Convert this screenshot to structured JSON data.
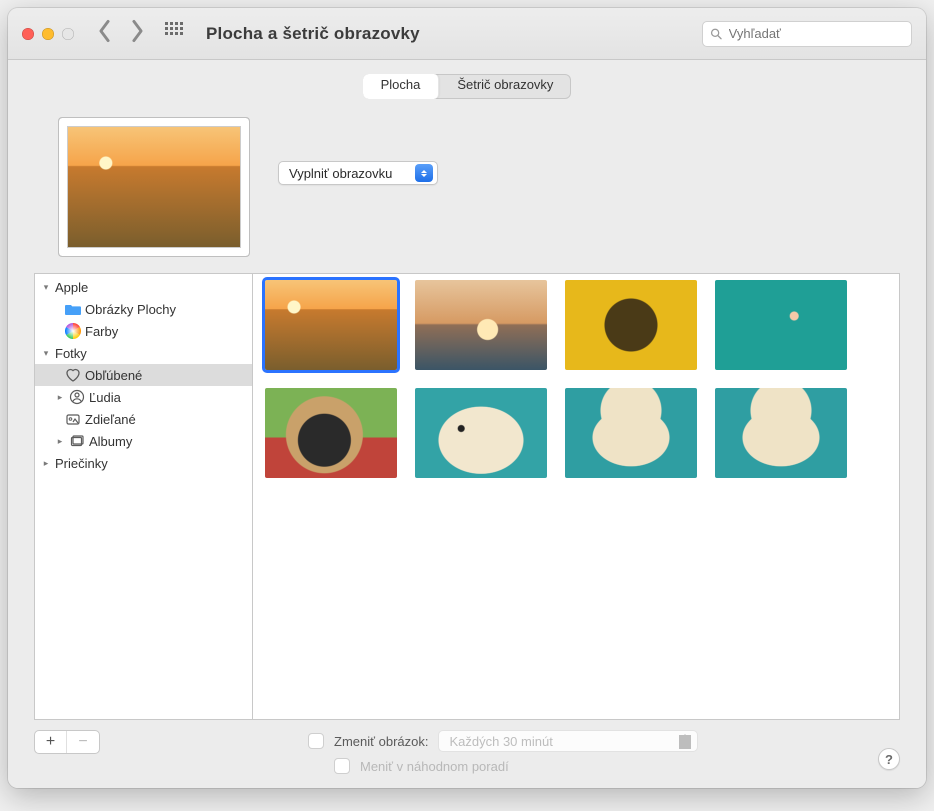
{
  "window": {
    "title": "Plocha a šetrič obrazovky"
  },
  "toolbar": {
    "search_placeholder": "Vyhľadať"
  },
  "tabs": {
    "desktop": "Plocha",
    "screensaver": "Šetrič obrazovky"
  },
  "fill_mode": {
    "selected": "Vyplniť obrazovku"
  },
  "sidebar": {
    "apple": {
      "label": "Apple",
      "desktop_pictures": "Obrázky Plochy",
      "colors": "Farby"
    },
    "photos": {
      "label": "Fotky",
      "favorites": "Obľúbené",
      "people": "Ľudia",
      "shared": "Zdieľané",
      "albums": "Albumy"
    },
    "folders": {
      "label": "Priečinky"
    }
  },
  "footer": {
    "change_picture_label": "Zmeniť obrázok:",
    "interval_value": "Každých 30 minút",
    "random_order_label": "Meniť v náhodnom poradí",
    "help": "?"
  },
  "icons": {
    "plus": "+",
    "minus": "−"
  }
}
